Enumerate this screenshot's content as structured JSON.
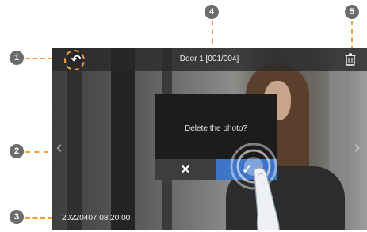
{
  "callouts": {
    "c1": "1",
    "c2": "2",
    "c3": "3",
    "c4": "4",
    "c5": "5"
  },
  "screen": {
    "title": "Door 1 [001/004]",
    "timestamp": "20220407 08:20:00",
    "icons": {
      "back": "back-arrow-icon",
      "delete": "trash-icon",
      "prev": "chevron-left-icon",
      "next": "chevron-right-icon"
    }
  },
  "dialog": {
    "message": "Delete the photo?",
    "cancel_label": "✕",
    "confirm_label": "✓",
    "confirm_color": "#3d75c8"
  },
  "colors": {
    "callout_line": "#f0a23a",
    "callout_badge": "#6c6c6c"
  }
}
